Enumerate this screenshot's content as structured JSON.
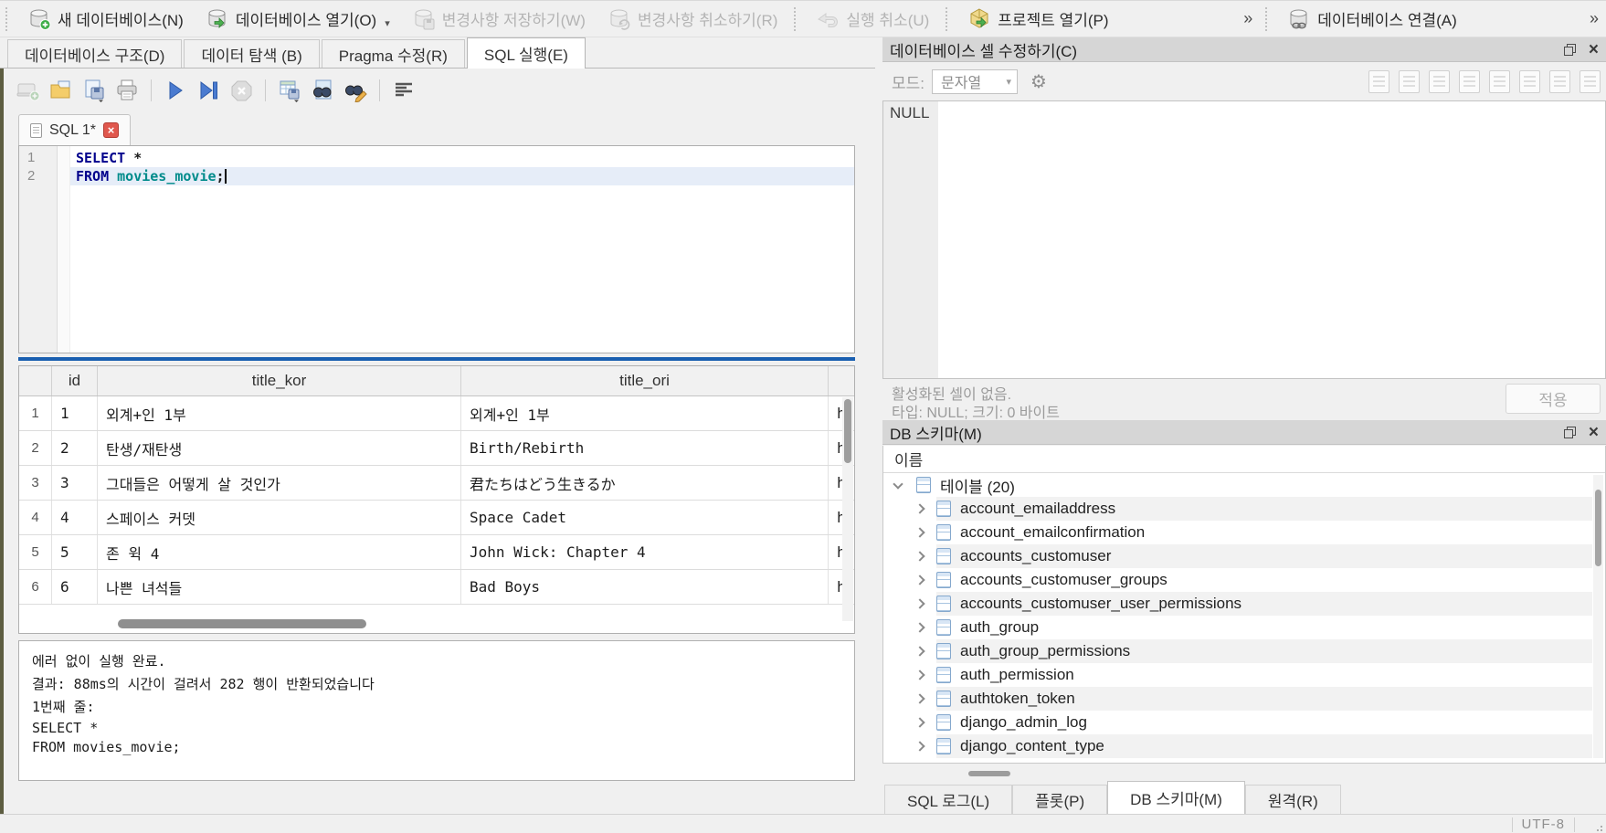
{
  "toolbar": {
    "buttons": [
      {
        "label": "새 데이터베이스(N)",
        "enabled": true
      },
      {
        "label": "데이터베이스 열기(O)",
        "enabled": true,
        "has_dropdown": true
      },
      {
        "label": "변경사항 저장하기(W)",
        "enabled": false
      },
      {
        "label": "변경사항 취소하기(R)",
        "enabled": false
      },
      {
        "label": "실행 취소(U)",
        "enabled": false
      },
      {
        "label": "프로젝트 열기(P)",
        "enabled": true
      },
      {
        "label": "데이터베이스 연결(A)",
        "enabled": true
      }
    ],
    "overflow_chevron": "»"
  },
  "main_tabs": [
    {
      "label": "데이터베이스 구조(D)",
      "active": false
    },
    {
      "label": "데이터 탐색 (B)",
      "active": false
    },
    {
      "label": "Pragma 수정(R)",
      "active": false
    },
    {
      "label": "SQL 실행(E)",
      "active": true
    }
  ],
  "sql_tab": {
    "label": "SQL 1*"
  },
  "editor": {
    "lines": [
      {
        "num": "1",
        "current": false,
        "tokens": [
          {
            "text": "SELECT",
            "cls": "kw"
          },
          {
            "text": " *",
            "cls": "op"
          }
        ]
      },
      {
        "num": "2",
        "current": true,
        "tokens": [
          {
            "text": "FROM",
            "cls": "kw"
          },
          {
            "text": " movies_movie",
            "cls": "ident"
          },
          {
            "text": ";",
            "cls": "op"
          }
        ]
      }
    ]
  },
  "results": {
    "columns": [
      "id",
      "title_kor",
      "title_ori"
    ],
    "rows": [
      {
        "num": "1",
        "id": "1",
        "title_kor": "외계+인 1부",
        "title_ori": "외계+인 1부",
        "clipped": "h"
      },
      {
        "num": "2",
        "id": "2",
        "title_kor": "탄생/재탄생",
        "title_ori": "Birth/Rebirth",
        "clipped": "h"
      },
      {
        "num": "3",
        "id": "3",
        "title_kor": "그대들은 어떻게 살 것인가",
        "title_ori": "君たちはどう生きるか",
        "clipped": "h"
      },
      {
        "num": "4",
        "id": "4",
        "title_kor": "스페이스 커뎃",
        "title_ori": "Space Cadet",
        "clipped": "h"
      },
      {
        "num": "5",
        "id": "5",
        "title_kor": "존 윅 4",
        "title_ori": "John Wick: Chapter 4",
        "clipped": "h"
      },
      {
        "num": "6",
        "id": "6",
        "title_kor": "나쁜 녀석들",
        "title_ori": "Bad Boys",
        "clipped": "h"
      }
    ]
  },
  "log": {
    "lines": [
      "에러 없이 실행 완료.",
      "결과: 88ms의 시간이 걸려서 282 행이 반환되었습니다",
      "1번째 줄:",
      "SELECT *",
      "FROM movies_movie;"
    ]
  },
  "cell_editor": {
    "title": "데이터베이스 셀 수정하기(C)",
    "mode_label": "모드:",
    "mode_value": "문자열",
    "content": "NULL",
    "status_line1": "활성화된 셀이 없음.",
    "status_line2": "타입: NULL; 크기: 0 바이트",
    "apply_label": "적용",
    "icons": [
      "import-text-icon",
      "word-wrap-icon",
      "open-external-icon",
      "save-as-icon",
      "export-data-icon",
      "copy-link-icon",
      "set-null-icon",
      "print-cell-icon"
    ]
  },
  "schema": {
    "title": "DB 스키마(M)",
    "column_header": "이름",
    "root_label": "테이블 (20)",
    "tables": [
      "account_emailaddress",
      "account_emailconfirmation",
      "accounts_customuser",
      "accounts_customuser_groups",
      "accounts_customuser_user_permissions",
      "auth_group",
      "auth_group_permissions",
      "auth_permission",
      "authtoken_token",
      "django_admin_log",
      "django_content_type"
    ]
  },
  "bottom_tabs": [
    {
      "label": "SQL 로그(L)",
      "active": false
    },
    {
      "label": "플롯(P)",
      "active": false
    },
    {
      "label": "DB 스키마(M)",
      "active": true
    },
    {
      "label": "원격(R)",
      "active": false
    }
  ],
  "statusbar": {
    "encoding": "UTF-8"
  },
  "colors": {
    "splitter_blue": "#1a5fb0",
    "keyword": "#00008c",
    "identifier": "#008b8b",
    "current_line": "#e6edf8",
    "tab_close_red": "#e0574d",
    "olive_edge": "#5d5d41"
  }
}
